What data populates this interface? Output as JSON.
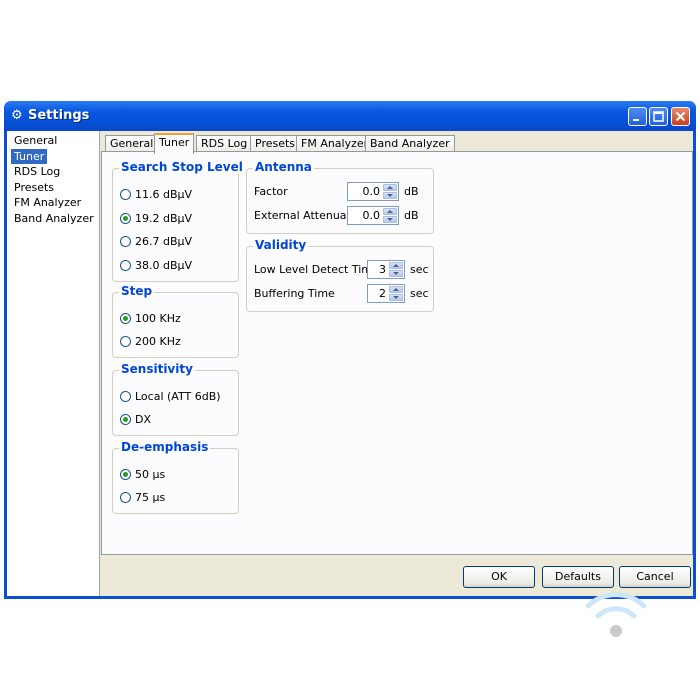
{
  "window": {
    "title": "Settings",
    "icon": "gears-icon"
  },
  "nav": {
    "items": [
      {
        "label": "General",
        "selected": false
      },
      {
        "label": "Tuner",
        "selected": true
      },
      {
        "label": "RDS Log",
        "selected": false
      },
      {
        "label": "Presets",
        "selected": false
      },
      {
        "label": "FM Analyzer",
        "selected": false
      },
      {
        "label": "Band Analyzer",
        "selected": false
      }
    ]
  },
  "tabs": [
    {
      "label": "General",
      "selected": false
    },
    {
      "label": "Tuner",
      "selected": true
    },
    {
      "label": "RDS Log",
      "selected": false
    },
    {
      "label": "Presets",
      "selected": false
    },
    {
      "label": "FM Analyzer",
      "selected": false
    },
    {
      "label": "Band Analyzer",
      "selected": false
    }
  ],
  "search_stop_level": {
    "title": "Search Stop Level",
    "options": [
      "11.6 dBµV",
      "19.2 dBµV",
      "26.7 dBµV",
      "38.0 dBµV"
    ],
    "selected": "19.2 dBµV"
  },
  "step": {
    "title": "Step",
    "options": [
      "100 KHz",
      "200 KHz"
    ],
    "selected": "100 KHz"
  },
  "sensitivity": {
    "title": "Sensitivity",
    "options": [
      "Local (ATT 6dB)",
      "DX"
    ],
    "selected": "DX"
  },
  "de_emphasis": {
    "title": "De-emphasis",
    "options": [
      "50 µs",
      "75 µs"
    ],
    "selected": "50 µs"
  },
  "antenna": {
    "title": "Antenna",
    "factor_label": "Factor",
    "factor_value": "0.0",
    "factor_unit": "dB",
    "ext_label": "External Attenuator",
    "ext_value": "0.0",
    "ext_unit": "dB"
  },
  "validity": {
    "title": "Validity",
    "low_label": "Low Level Detect Time",
    "low_value": "3",
    "low_unit": "sec",
    "buf_label": "Buffering Time",
    "buf_value": "2",
    "buf_unit": "sec"
  },
  "buttons": {
    "ok": "OK",
    "defaults": "Defaults",
    "cancel": "Cancel"
  },
  "colors": {
    "titlebar": "#0a58e0",
    "group_title": "#0046d5",
    "selection": "#316ac5",
    "radio_dot": "#21a121"
  }
}
